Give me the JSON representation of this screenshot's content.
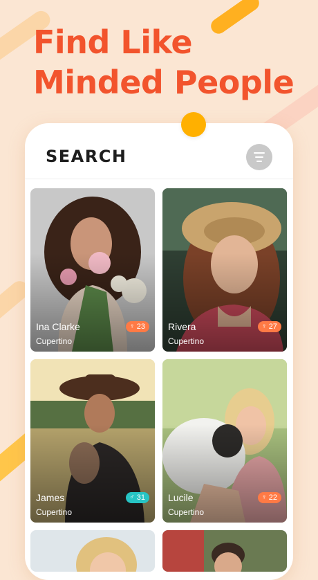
{
  "headline": {
    "line1": "Find Like",
    "line2": "Minded People"
  },
  "screen": {
    "title": "SEARCH",
    "filter_icon": "filter-lines-icon"
  },
  "colors": {
    "accent": "#f2542d",
    "badge_female": "#ff7a45",
    "badge_male": "#27c4c4",
    "background": "#fbe6d3"
  },
  "profiles": [
    {
      "name": "Ina Clarke",
      "city": "Cupertino",
      "age": "23",
      "gender": "female"
    },
    {
      "name": "Rivera",
      "city": "Cupertino",
      "age": "27",
      "gender": "female"
    },
    {
      "name": "James",
      "city": "Cupertino",
      "age": "31",
      "gender": "male"
    },
    {
      "name": "Lucile",
      "city": "Cupertino",
      "age": "22",
      "gender": "female"
    }
  ]
}
